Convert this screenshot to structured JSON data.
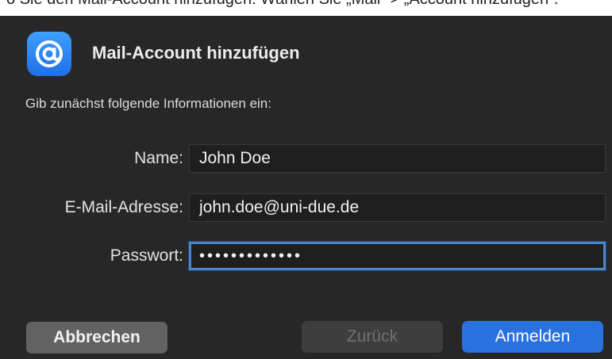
{
  "top_strip": {
    "partial_text": "o Sie den Mail-Account hinzufügen: Wählen Sie „Mail“ > „Account hinzufügen“."
  },
  "dialog": {
    "icon": "at-sign-icon",
    "title": "Mail-Account hinzufügen",
    "intro": "Gib zunächst folgende Informationen ein:",
    "fields": {
      "name": {
        "label": "Name:",
        "value": "John Doe"
      },
      "email": {
        "label": "E-Mail-Adresse:",
        "value": "john.doe@uni-due.de"
      },
      "password": {
        "label": "Passwort:",
        "value": "•••••••••••••"
      }
    },
    "buttons": {
      "cancel": "Abbrechen",
      "back": "Zurück",
      "login": "Anmelden"
    }
  },
  "colors": {
    "dialog_bg": "#272727",
    "accent": "#2a71e0",
    "focus_ring": "#4a84c9"
  }
}
